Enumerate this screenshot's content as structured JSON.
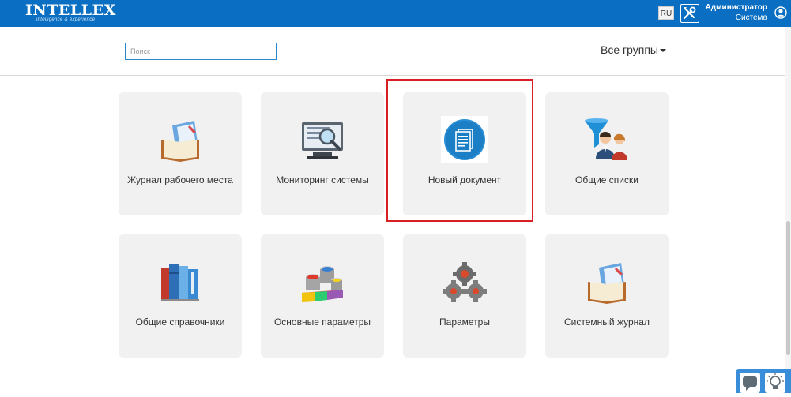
{
  "header": {
    "logo_text": "INTELLEX",
    "logo_tagline": "intelligence & experience",
    "language": "RU",
    "user_name": "Администратор",
    "user_role": "Система",
    "colors": {
      "bar": "#0a6fc2"
    }
  },
  "toolbar": {
    "search_placeholder": "Поиск",
    "groups_label": "Все группы"
  },
  "tiles": [
    {
      "label": "Журнал рабочего места",
      "icon": "journal-book-icon"
    },
    {
      "label": "Мониторинг системы",
      "icon": "monitor-magnifier-icon"
    },
    {
      "label": "Новый документ",
      "icon": "document-circle-icon",
      "highlighted": true
    },
    {
      "label": "Общие списки",
      "icon": "filter-users-icon"
    },
    {
      "label": "Общие справочники",
      "icon": "books-icon"
    },
    {
      "label": "Основные параметры",
      "icon": "paint-cans-icon"
    },
    {
      "label": "Параметры",
      "icon": "gears-icon"
    },
    {
      "label": "Системный журнал",
      "icon": "journal-book-icon"
    }
  ],
  "highlight_color": "#d91f26"
}
